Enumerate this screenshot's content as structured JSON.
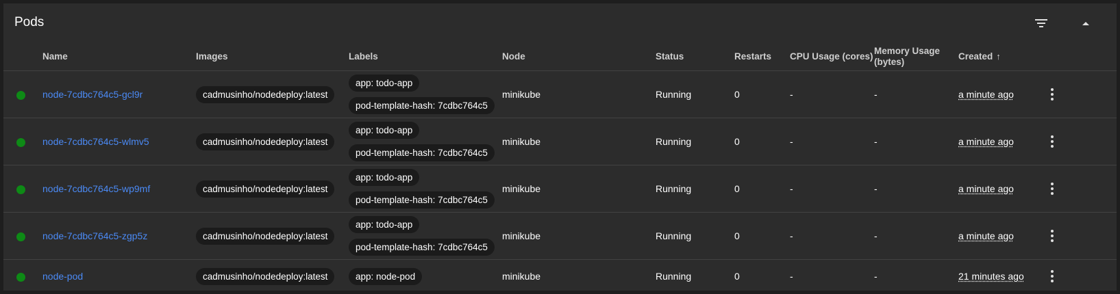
{
  "card": {
    "title": "Pods"
  },
  "columns": {
    "name": "Name",
    "images": "Images",
    "labels": "Labels",
    "node": "Node",
    "status": "Status",
    "restarts": "Restarts",
    "cpu": "CPU Usage (cores)",
    "memory_line1": "Memory Usage",
    "memory_line2": "(bytes)",
    "created": "Created",
    "sort_arrow": "↑"
  },
  "colors": {
    "running_dot": "#0e8a16",
    "link": "#4b8af5",
    "card_bg": "#2c2c2c",
    "chip_bg": "#1b1b1b"
  },
  "pods": [
    {
      "name": "node-7cdbc764c5-gcl9r",
      "image": "cadmusinho/nodedeploy:latest",
      "labels": [
        "app: todo-app",
        "pod-template-hash: 7cdbc764c5"
      ],
      "node": "minikube",
      "status": "Running",
      "restarts": "0",
      "cpu": "-",
      "memory": "-",
      "created": "a minute ago"
    },
    {
      "name": "node-7cdbc764c5-wlmv5",
      "image": "cadmusinho/nodedeploy:latest",
      "labels": [
        "app: todo-app",
        "pod-template-hash: 7cdbc764c5"
      ],
      "node": "minikube",
      "status": "Running",
      "restarts": "0",
      "cpu": "-",
      "memory": "-",
      "created": "a minute ago"
    },
    {
      "name": "node-7cdbc764c5-wp9mf",
      "image": "cadmusinho/nodedeploy:latest",
      "labels": [
        "app: todo-app",
        "pod-template-hash: 7cdbc764c5"
      ],
      "node": "minikube",
      "status": "Running",
      "restarts": "0",
      "cpu": "-",
      "memory": "-",
      "created": "a minute ago"
    },
    {
      "name": "node-7cdbc764c5-zgp5z",
      "image": "cadmusinho/nodedeploy:latest",
      "labels": [
        "app: todo-app",
        "pod-template-hash: 7cdbc764c5"
      ],
      "node": "minikube",
      "status": "Running",
      "restarts": "0",
      "cpu": "-",
      "memory": "-",
      "created": "a minute ago"
    },
    {
      "name": "node-pod",
      "image": "cadmusinho/nodedeploy:latest",
      "labels": [
        "app: node-pod"
      ],
      "node": "minikube",
      "status": "Running",
      "restarts": "0",
      "cpu": "-",
      "memory": "-",
      "created": "21 minutes ago"
    }
  ]
}
